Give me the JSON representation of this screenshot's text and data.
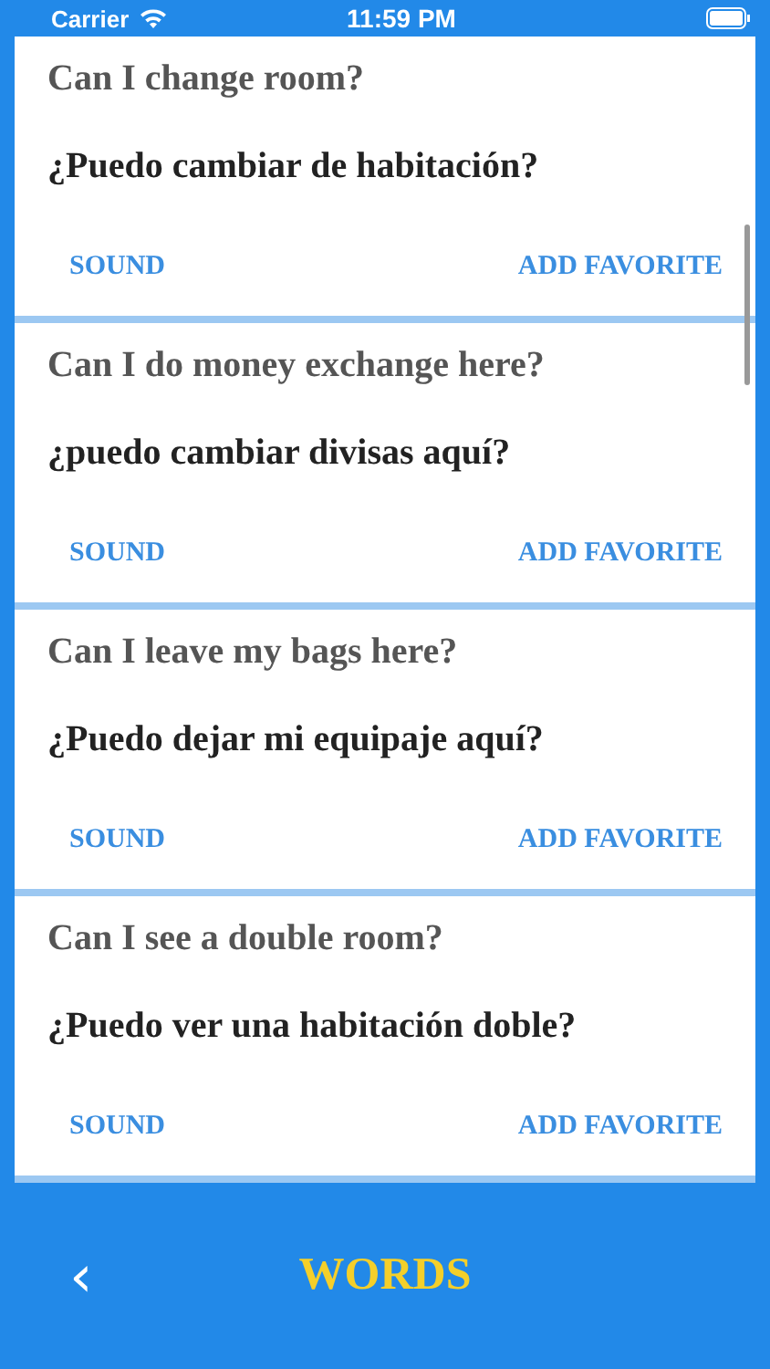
{
  "status_bar": {
    "carrier": "Carrier",
    "time": "11:59 PM"
  },
  "phrases": [
    {
      "english": "Can I change room?",
      "spanish": "¿Puedo cambiar de habitación?",
      "actions": [
        "SOUND",
        "ADD FAVORITE"
      ]
    },
    {
      "english": "Can I do money exchange here?",
      "spanish": "¿puedo cambiar divisas aquí?",
      "actions": [
        "SOUND",
        "ADD FAVORITE"
      ]
    },
    {
      "english": "Can I leave my bags here?",
      "spanish": "¿Puedo dejar mi equipaje aquí?",
      "actions": [
        "SOUND",
        "ADD FAVORITE"
      ]
    },
    {
      "english": "Can I see a double room?",
      "spanish": "¿Puedo ver una habitación doble?",
      "actions": [
        "SOUND",
        "ADD FAVORITE"
      ]
    }
  ],
  "nav": {
    "back": "‹",
    "title": "WORDS"
  }
}
